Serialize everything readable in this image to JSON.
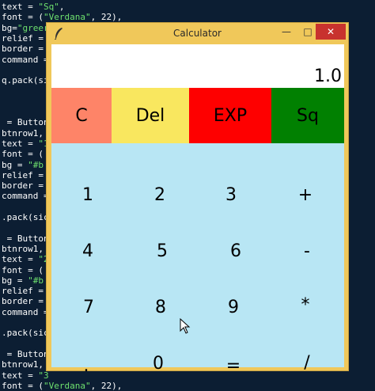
{
  "editor": {
    "lines": [
      {
        "pre": "text = ",
        "str": "\"Sq\"",
        "post": ","
      },
      {
        "pre": "font = (",
        "str": "\"Verdana\"",
        "post": ", 22),"
      },
      {
        "pre": "bg=",
        "str": "\"greer",
        "post": ""
      },
      {
        "pre": "relief = ",
        "str": "",
        "post": ""
      },
      {
        "pre": "border = ",
        "str": "",
        "post": ""
      },
      {
        "pre": "command = ",
        "str": "",
        "post": ""
      },
      {
        "pre": "",
        "str": "",
        "post": ""
      },
      {
        "pre": "q.pack(si",
        "str": "",
        "post": ""
      },
      {
        "pre": "",
        "str": "",
        "post": ""
      },
      {
        "pre": "",
        "str": "",
        "post": ""
      },
      {
        "pre": "",
        "str": "",
        "post": ""
      },
      {
        "pre": " = Button",
        "str": "",
        "post": ""
      },
      {
        "pre": "btnrow1,",
        "str": "",
        "post": ""
      },
      {
        "pre": "text = ",
        "str": "\"1",
        "post": ""
      },
      {
        "pre": "font = (",
        "str": "",
        "post": ""
      },
      {
        "pre": "bg = ",
        "str": "\"#b",
        "post": ""
      },
      {
        "pre": "relief = ",
        "str": "",
        "post": ""
      },
      {
        "pre": "border = ",
        "str": "",
        "post": ""
      },
      {
        "pre": "command =",
        "str": "",
        "post": ""
      },
      {
        "pre": "",
        "str": "",
        "post": ""
      },
      {
        "pre": ".pack(sic",
        "str": "",
        "post": ""
      },
      {
        "pre": "",
        "str": "",
        "post": ""
      },
      {
        "pre": " = Button",
        "str": "",
        "post": ""
      },
      {
        "pre": "btnrow1,",
        "str": "",
        "post": ""
      },
      {
        "pre": "text = ",
        "str": "\"2",
        "post": ""
      },
      {
        "pre": "font = (",
        "str": "",
        "post": ""
      },
      {
        "pre": "bg = ",
        "str": "\"#b",
        "post": ""
      },
      {
        "pre": "relief = ",
        "str": "",
        "post": ""
      },
      {
        "pre": "border = ",
        "str": "",
        "post": ""
      },
      {
        "pre": "command =",
        "str": "",
        "post": ""
      },
      {
        "pre": "",
        "str": "",
        "post": ""
      },
      {
        "pre": ".pack(sic",
        "str": "",
        "post": ""
      },
      {
        "pre": "",
        "str": "",
        "post": ""
      },
      {
        "pre": " = Button",
        "str": "",
        "post": ""
      },
      {
        "pre": "btnrow1,",
        "str": "",
        "post": ""
      },
      {
        "pre": "text = ",
        "str": "\"3",
        "post": ""
      },
      {
        "pre": "font = (",
        "str": "\"Verdana\"",
        "post": ", 22),"
      }
    ]
  },
  "window": {
    "title": "Calculator",
    "icon": "feather-icon",
    "controls": {
      "minimize": "—",
      "maximize": "□",
      "close": "✕"
    }
  },
  "display": {
    "value": "1.0"
  },
  "top_buttons": [
    {
      "label": "C",
      "color": "#fe8468"
    },
    {
      "label": "Del",
      "color": "#f9e75f"
    },
    {
      "label": "EXP",
      "color": "#fe0000"
    },
    {
      "label": "Sq",
      "color": "#018001"
    }
  ],
  "keypad": {
    "background": "#b8e6f4",
    "rows": [
      [
        "1",
        "2",
        "3",
        "+"
      ],
      [
        "4",
        "5",
        "6",
        "-"
      ],
      [
        "7",
        "8",
        "9",
        "*"
      ],
      [
        ".",
        "0",
        "=",
        "/"
      ]
    ]
  }
}
